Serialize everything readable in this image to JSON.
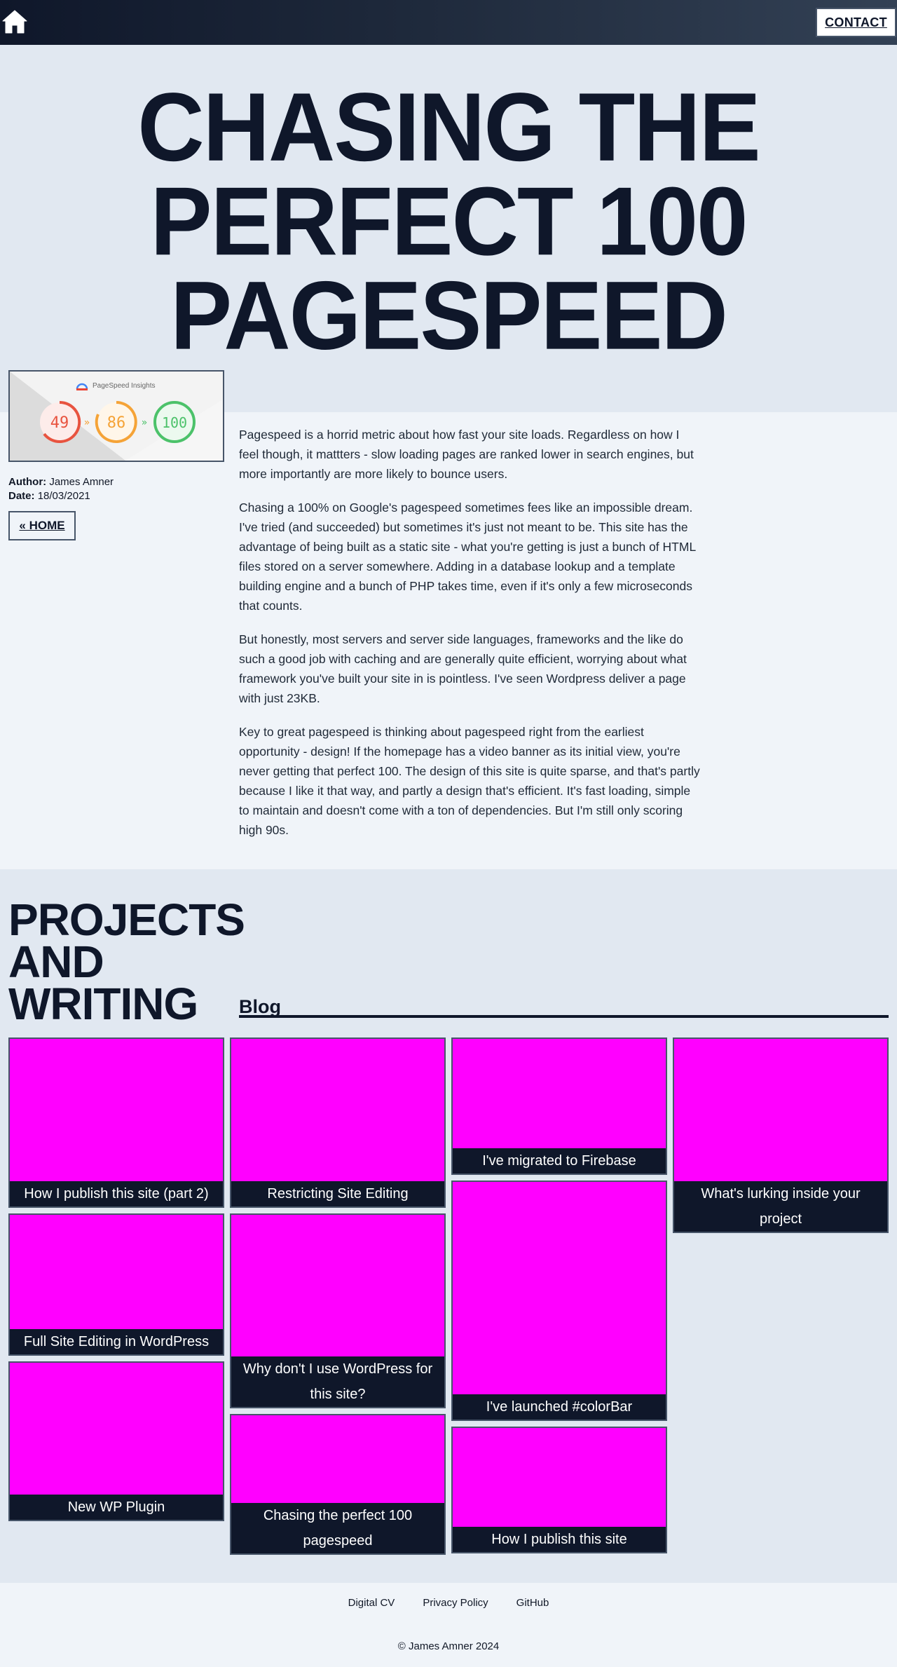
{
  "header": {
    "home_icon": "house-icon",
    "contact_label": "CONTACT"
  },
  "hero": {
    "title_line1": "CHASING THE",
    "title_line2": "PERFECT 100",
    "title_line3": "PAGESPEED"
  },
  "thumbnail": {
    "brand": "PageSpeed Insights",
    "scores": [
      "49",
      "86",
      "100"
    ],
    "colors": {
      "red": "#e8533f",
      "orange": "#f5a337",
      "green": "#4cc26a"
    }
  },
  "meta": {
    "author_label": "Author:",
    "author": "James Amner",
    "date_label": "Date:",
    "date": "18/03/2021",
    "home_link": "« HOME"
  },
  "article": {
    "paragraphs": [
      "Pagespeed is a horrid metric about how fast your site loads. Regardless on how I feel though, it mattters - slow loading pages are ranked lower in search engines, but more importantly are more likely to bounce users.",
      "Chasing a 100% on Google's pagespeed sometimes fees like an impossible dream. I've tried (and succeeded) but sometimes it's just not meant to be. This site has the advantage of being built as a static site - what you're getting is just a bunch of HTML files stored on a server somewhere. Adding in a database lookup and a template building engine and a bunch of PHP takes time, even if it's only a few microseconds that counts.",
      "But honestly, most servers and server side languages, frameworks and the like do such a good job with caching and are generally quite efficient, worrying about what framework you've built your site in is pointless. I've seen Wordpress deliver a page with just 23KB.",
      "Key to great pagespeed is thinking about pagespeed right from the earliest opportunity - design! If the homepage has a video banner as its initial view, you're never getting that perfect 100. The design of this site is quite sparse, and that's partly because I like it that way, and partly a design that's efficient. It's fast loading, simple to maintain and doesn't come with a ton of dependencies. But I'm still only scoring high 90s."
    ]
  },
  "projects": {
    "heading_line1": "PROJECTS",
    "heading_line2": "AND",
    "heading_line3": "WRITING",
    "blog_heading": "Blog",
    "cards": [
      "How I publish this site (part 2)",
      "Restricting Site Editing",
      "I've migrated to Firebase",
      "What's lurking inside your project",
      "Full Site Editing in WordPress",
      "Why don't I use WordPress for this site?",
      "I've launched #colorBar",
      "New WP Plugin",
      "Chasing the perfect 100 pagespeed",
      "How I publish this site"
    ]
  },
  "footer": {
    "links": [
      "Digital CV",
      "Privacy Policy",
      "GitHub"
    ],
    "copyright": "© James Amner 2024"
  }
}
